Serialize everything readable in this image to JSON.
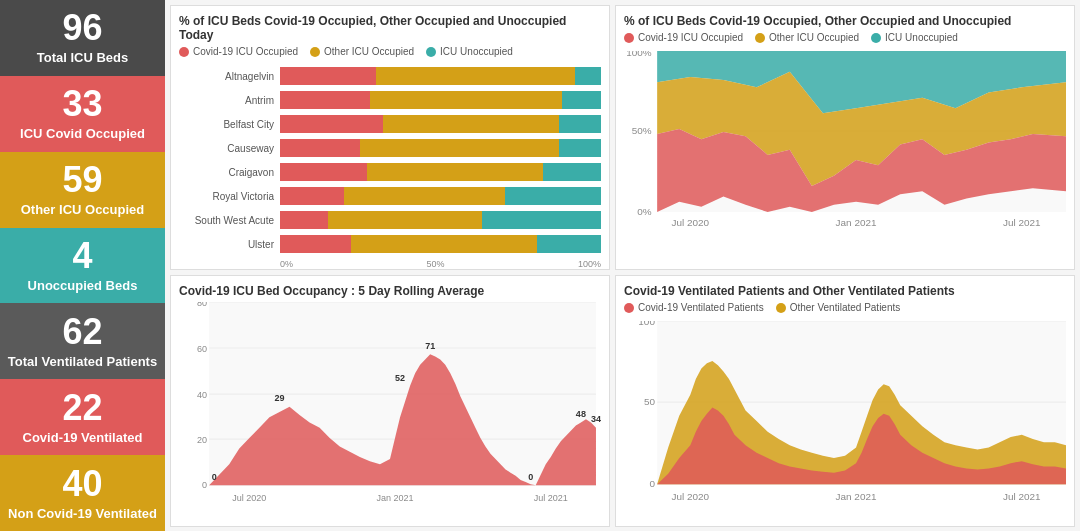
{
  "sidebar": {
    "stats": [
      {
        "number": "96",
        "label": "Total ICU Beds",
        "color": "dark-gray"
      },
      {
        "number": "33",
        "label": "ICU Covid Occupied",
        "color": "red"
      },
      {
        "number": "59",
        "label": "Other ICU Occupied",
        "color": "orange"
      },
      {
        "number": "4",
        "label": "Unoccupied Beds",
        "color": "teal"
      },
      {
        "number": "62",
        "label": "Total Ventilated Patients",
        "color": "dark-gray2"
      },
      {
        "number": "22",
        "label": "Covid-19 Ventilated",
        "color": "red2"
      },
      {
        "number": "40",
        "label": "Non Covid-19 Ventilated",
        "color": "orange2"
      }
    ]
  },
  "bar_chart": {
    "title": "% of ICU Beds Covid-19 Occupied, Other Occupied and Unoccupied Today",
    "legend": [
      {
        "label": "Covid-19 ICU Occupied",
        "color": "#e05a5a"
      },
      {
        "label": "Other ICU Occupied",
        "color": "#d4a017"
      },
      {
        "label": "ICU Unoccupied",
        "color": "#3aada8"
      }
    ],
    "hospitals": [
      {
        "name": "Altnagelvin",
        "covid": 30,
        "other": 62,
        "unoccupied": 8
      },
      {
        "name": "Antrim",
        "covid": 28,
        "other": 60,
        "unoccupied": 12
      },
      {
        "name": "Belfast City",
        "covid": 32,
        "other": 55,
        "unoccupied": 13
      },
      {
        "name": "Causeway",
        "covid": 25,
        "other": 62,
        "unoccupied": 13
      },
      {
        "name": "Craigavon",
        "covid": 27,
        "other": 55,
        "unoccupied": 18
      },
      {
        "name": "Royal Victoria",
        "covid": 20,
        "other": 50,
        "unoccupied": 30
      },
      {
        "name": "South West Acute",
        "covid": 15,
        "other": 48,
        "unoccupied": 37
      },
      {
        "name": "Ulster",
        "covid": 22,
        "other": 58,
        "unoccupied": 20
      }
    ],
    "x_axis": [
      "0%",
      "50%",
      "100%"
    ]
  },
  "stacked_area_chart": {
    "title": "% of ICU Beds Covid-19 Occupied, Other Occupied and Unoccupied",
    "legend": [
      {
        "label": "Covid-19 ICU Occupied",
        "color": "#e05a5a"
      },
      {
        "label": "Other ICU Occupied",
        "color": "#d4a017"
      },
      {
        "label": "ICU Unoccupied",
        "color": "#3aada8"
      }
    ],
    "x_labels": [
      "Jul 2020",
      "Jan 2021",
      "Jul 2021"
    ],
    "y_labels": [
      "0%",
      "50%",
      "100%"
    ]
  },
  "line_chart": {
    "title": "Covid-19 ICU Bed Occupancy : 5 Day Rolling Average",
    "annotations": [
      "71",
      "52",
      "29",
      "48",
      "34",
      "0",
      "0"
    ],
    "x_labels": [
      "Jul 2020",
      "Jan 2021",
      "Jul 2021"
    ],
    "y_labels": [
      "0",
      "20",
      "40",
      "60",
      "80"
    ]
  },
  "ventilated_chart": {
    "title": "Covid-19 Ventilated Patients and Other Ventilated Patients",
    "legend": [
      {
        "label": "Covid-19 Ventilated Patients",
        "color": "#e05a5a"
      },
      {
        "label": "Other Ventilated Patients",
        "color": "#d4a017"
      }
    ],
    "x_labels": [
      "Jul 2020",
      "Jan 2021",
      "Jul 2021"
    ],
    "y_labels": [
      "0",
      "50",
      "100"
    ]
  }
}
